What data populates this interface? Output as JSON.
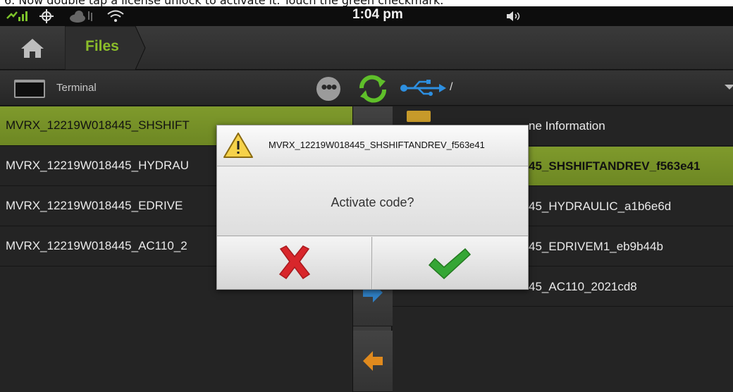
{
  "caption": "6. Now double tap a license unlock to activate it. Touch the green checkmark.",
  "status_bar": {
    "time": "1:04 pm",
    "icons": [
      "signal-icon",
      "network-icon",
      "cloud-sync-icon",
      "wifi-icon",
      "volume-icon"
    ]
  },
  "nav": {
    "home_icon": "home-icon",
    "crumb_label": "Files"
  },
  "toolbar": {
    "source_label": "Terminal",
    "path": "/",
    "icons": [
      "terminal-icon",
      "more-icon",
      "refresh-icon",
      "usb-icon",
      "dropdown-icon"
    ]
  },
  "left_list": {
    "items": [
      {
        "label": "MVRX_12219W018445_SHSHIFT",
        "selected": true
      },
      {
        "label": "MVRX_12219W018445_HYDRAU",
        "selected": false
      },
      {
        "label": "MVRX_12219W018445_EDRIVE",
        "selected": false
      },
      {
        "label": "MVRX_12219W018445_AC110_2",
        "selected": false
      }
    ]
  },
  "right_list": {
    "items": [
      {
        "label": "ne Information",
        "selected": false,
        "folder": true
      },
      {
        "label": "45_SHSHIFTANDREV_f563e41",
        "selected": true
      },
      {
        "label": "45_HYDRAULIC_a1b6e6d",
        "selected": false
      },
      {
        "label": "45_EDRIVEM1_eb9b44b",
        "selected": false
      },
      {
        "label": "45_AC110_2021cd8",
        "selected": false
      }
    ]
  },
  "rail": {
    "icons": [
      "copy-right-arrow-icon",
      "copy-left-arrow-icon"
    ],
    "colors": {
      "right_arrow": "#2f7fc4",
      "left_arrow": "#e08a1e"
    }
  },
  "dialog": {
    "title": "MVRX_12219W018445_SHSHIFTANDREV_f563e41",
    "message": "Activate code?",
    "icon": "warning-icon",
    "cancel_icon": "red-x-icon",
    "confirm_icon": "green-checkmark-icon"
  },
  "colors": {
    "accent_green": "#8bbd2a",
    "selected_row": "#7b962b",
    "cancel_red": "#d8262b",
    "confirm_green": "#35a635"
  }
}
